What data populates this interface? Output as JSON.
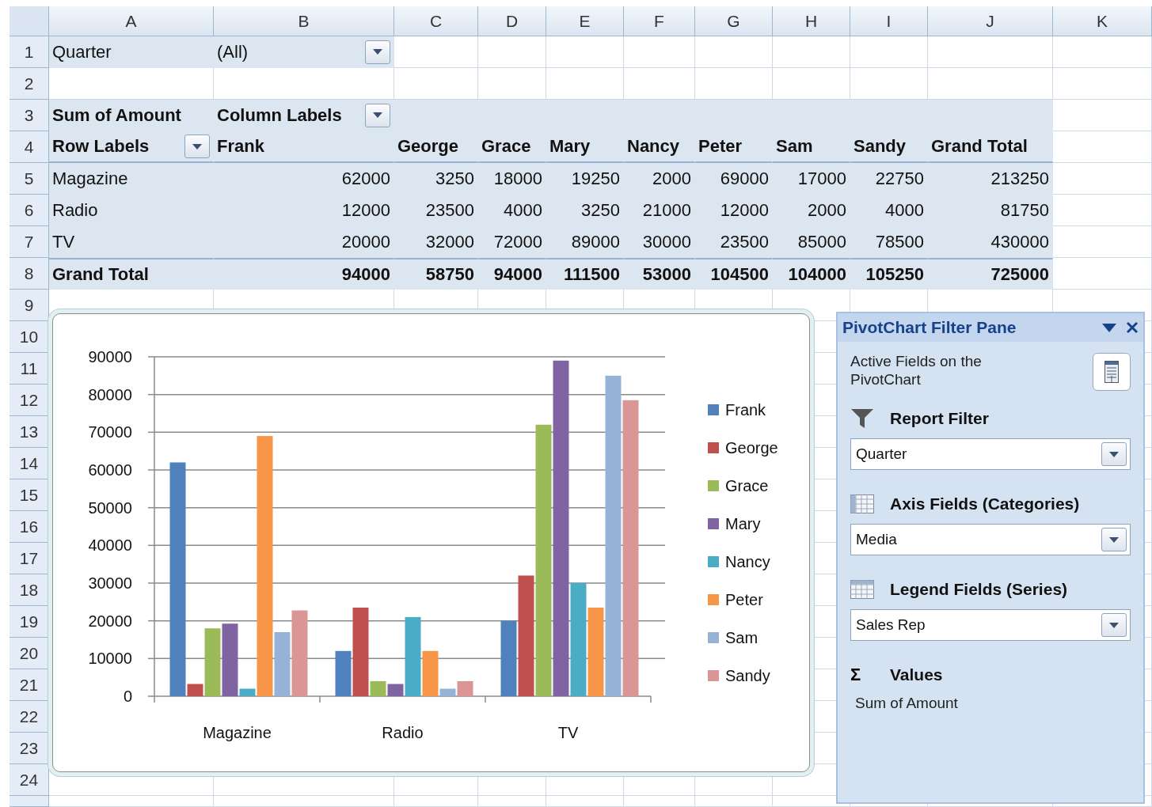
{
  "sheet": {
    "columns": [
      "A",
      "B",
      "C",
      "D",
      "E",
      "F",
      "G",
      "H",
      "I",
      "J",
      "K"
    ],
    "rows": [
      "1",
      "2",
      "3",
      "4",
      "5",
      "6",
      "7",
      "8",
      "9",
      "10",
      "11",
      "12",
      "13",
      "14",
      "15",
      "16",
      "17",
      "18",
      "19",
      "20",
      "21",
      "22",
      "23",
      "24"
    ]
  },
  "pivot": {
    "filter_label": "Quarter",
    "filter_value": "(All)",
    "value_header": "Sum of Amount",
    "column_labels": "Column Labels",
    "row_labels": "Row Labels",
    "columns": [
      "Frank",
      "George",
      "Grace",
      "Mary",
      "Nancy",
      "Peter",
      "Sam",
      "Sandy",
      "Grand Total"
    ],
    "rows": [
      {
        "label": "Magazine",
        "values": [
          "62000",
          "3250",
          "18000",
          "19250",
          "2000",
          "69000",
          "17000",
          "22750",
          "213250"
        ]
      },
      {
        "label": "Radio",
        "values": [
          "12000",
          "23500",
          "4000",
          "3250",
          "21000",
          "12000",
          "2000",
          "4000",
          "81750"
        ]
      },
      {
        "label": "TV",
        "values": [
          "20000",
          "32000",
          "72000",
          "89000",
          "30000",
          "23500",
          "85000",
          "78500",
          "430000"
        ]
      }
    ],
    "grand_total": {
      "label": "Grand Total",
      "values": [
        "94000",
        "58750",
        "94000",
        "111500",
        "53000",
        "104500",
        "104000",
        "105250",
        "725000"
      ]
    }
  },
  "chart": {
    "chart_data": {
      "type": "bar",
      "legend": "right",
      "categories": [
        "Magazine",
        "Radio",
        "TV"
      ],
      "ylim": [
        0,
        90000
      ],
      "yticks": [
        0,
        10000,
        20000,
        30000,
        40000,
        50000,
        60000,
        70000,
        80000,
        90000
      ],
      "series": [
        {
          "name": "Frank",
          "color": "#4f81bd",
          "values": [
            62000,
            12000,
            20000
          ]
        },
        {
          "name": "George",
          "color": "#c0504d",
          "values": [
            3250,
            23500,
            32000
          ]
        },
        {
          "name": "Grace",
          "color": "#9bbb59",
          "values": [
            18000,
            4000,
            72000
          ]
        },
        {
          "name": "Mary",
          "color": "#8064a2",
          "values": [
            19250,
            3250,
            89000
          ]
        },
        {
          "name": "Nancy",
          "color": "#4bacc6",
          "values": [
            2000,
            21000,
            30000
          ]
        },
        {
          "name": "Peter",
          "color": "#f79646",
          "values": [
            69000,
            12000,
            23500
          ]
        },
        {
          "name": "Sam",
          "color": "#95b3d7",
          "values": [
            17000,
            2000,
            85000
          ]
        },
        {
          "name": "Sandy",
          "color": "#d99694",
          "values": [
            22750,
            4000,
            78500
          ]
        }
      ]
    }
  },
  "filter_pane": {
    "title": "PivotChart Filter Pane",
    "caption": "Active Fields on the PivotChart",
    "sections": [
      {
        "kind": "filter",
        "title": "Report Filter",
        "field": "Quarter"
      },
      {
        "kind": "axis",
        "title": "Axis Fields (Categories)",
        "field": "Media"
      },
      {
        "kind": "legend",
        "title": "Legend Fields (Series)",
        "field": "Sales Rep"
      },
      {
        "kind": "values",
        "symbol": "Σ",
        "title": "Values",
        "item": "Sum of Amount"
      }
    ]
  }
}
